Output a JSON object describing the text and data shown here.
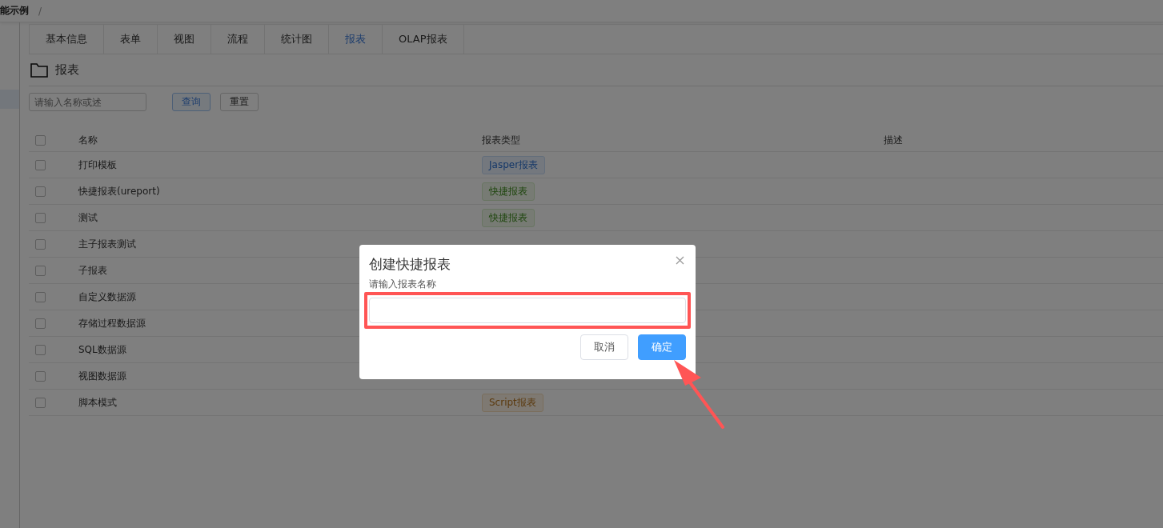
{
  "breadcrumb": {
    "current": "能示例",
    "separator": "/"
  },
  "tabs": [
    {
      "label": "基本信息",
      "selected": false
    },
    {
      "label": "表单",
      "selected": false
    },
    {
      "label": "视图",
      "selected": false
    },
    {
      "label": "流程",
      "selected": false
    },
    {
      "label": "统计图",
      "selected": false
    },
    {
      "label": "报表",
      "selected": true
    },
    {
      "label": "OLAP报表",
      "selected": false
    }
  ],
  "section_title": "报表",
  "search": {
    "placeholder": "请输入名称或述"
  },
  "buttons": [
    "查询",
    "重置"
  ],
  "table": {
    "columns": [
      "名称",
      "报表类型",
      "描述"
    ],
    "header_checked": false,
    "rows": [
      {
        "name": "打印模板",
        "type": "Jasper报表",
        "kind": "jasper",
        "checked": false
      },
      {
        "name": "快捷报表(ureport)",
        "type": "快捷报表",
        "kind": "quick",
        "checked": false
      },
      {
        "name": "测试",
        "type": "快捷报表",
        "kind": "quick",
        "checked": false
      },
      {
        "name": "主子报表测试",
        "checked": false
      },
      {
        "name": "子报表",
        "checked": false
      },
      {
        "name": "自定义数据源",
        "checked": false
      },
      {
        "name": "存储过程数据源",
        "checked": false
      },
      {
        "name": "SQL数据源",
        "checked": false
      },
      {
        "name": "视图数据源",
        "checked": false
      },
      {
        "name": "脚本模式",
        "type": "Script报表",
        "kind": "script",
        "checked": false
      }
    ]
  },
  "dialog": {
    "title": "创建快捷报表",
    "label": "请输入报表名称",
    "buttons": [
      {
        "label": "取消",
        "kind": "default"
      },
      {
        "label": "确定",
        "kind": "primary"
      }
    ]
  }
}
